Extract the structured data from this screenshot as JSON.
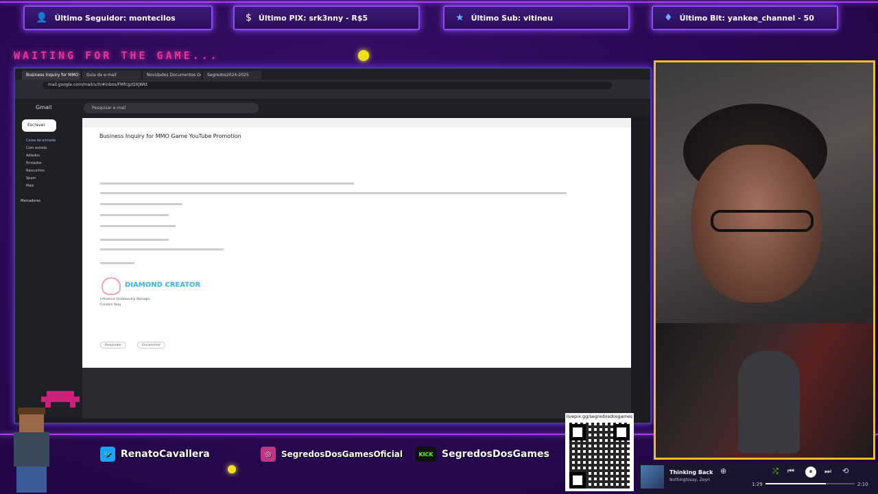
{
  "overlay": {
    "waiting_text": "WAITING FOR THE GAME...",
    "top_bars": [
      {
        "icon": "person-icon",
        "glyph": "👤",
        "label": "Último Seguidor: montecilos"
      },
      {
        "icon": "dollar-icon",
        "glyph": "$",
        "label": "Último PIX: srk3nny - R$5"
      },
      {
        "icon": "star-icon",
        "glyph": "★",
        "label": "Último Sub: vitineu"
      },
      {
        "icon": "diamond-icon",
        "glyph": "♦",
        "label": "Último Bit: yankee_channel - 50"
      }
    ],
    "social": {
      "twitter": "RenatoCavallera",
      "instagram": "SegredosDosGamesOficial",
      "kick_badge": "KICK",
      "kick": "SegredosDosGames"
    },
    "qr_url": "livepix.gg/segredosdosgames"
  },
  "browser": {
    "tabs": [
      "Business Inquiry for MMO Ga",
      "Guia de e-mail",
      "Novidades Documentos Google",
      "Segredos2024-2025"
    ],
    "address": "mail.google.com/mail/u/0/#inbox/FMfcgzQXJWkt"
  },
  "gmail": {
    "logo": "Gmail",
    "search_placeholder": "Pesquisar e-mail",
    "compose": "Escrever",
    "nav": [
      "Caixa de entrada",
      "Com estrela",
      "Adiados",
      "Enviados",
      "Rascunhos",
      "Spam",
      "Mais"
    ],
    "labels_header": "Marcadores",
    "subject": "Business Inquiry for MMO Game YouTube Promotion",
    "sender_name": "DIAMOND CREATOR",
    "signature": [
      "Influencer Relationship Manager",
      "Candice Yang"
    ],
    "reply": "Responder",
    "forward": "Encaminhar"
  },
  "music": {
    "title": "Thinking Back",
    "artist": "Nothingtosay, Zeyn",
    "current": "1:29",
    "total": "2:10",
    "progress": 0.68
  }
}
